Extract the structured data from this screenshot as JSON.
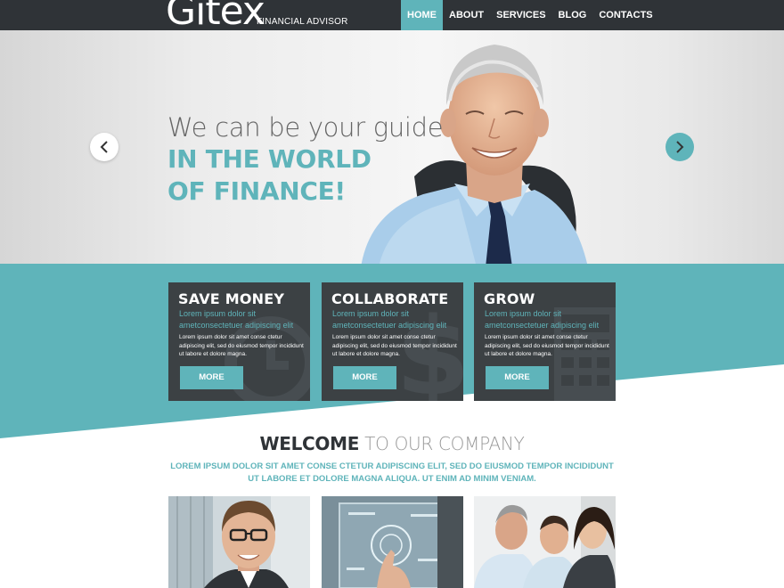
{
  "header": {
    "logo": "Gitex",
    "tagline": "FINANCIAL ADVISOR",
    "nav": [
      {
        "label": "HOME",
        "active": true
      },
      {
        "label": "ABOUT",
        "active": false
      },
      {
        "label": "SERVICES",
        "active": false
      },
      {
        "label": "BLOG",
        "active": false
      },
      {
        "label": "CONTACTS",
        "active": false
      }
    ]
  },
  "hero": {
    "line1": "We can be your guide",
    "line2": "IN THE WORLD",
    "line3": "OF FINANCE!",
    "prev_icon": "chevron-left-icon",
    "next_icon": "chevron-right-icon"
  },
  "cards": [
    {
      "title": "SAVE MONEY",
      "subtitle": "Lorem ipsum dolor sit ametconsectetuer adipiscing elit",
      "text": "Lorem ipsum dolor sit amet conse ctetur adipiscing elit, sed do eiusmod tempor incididunt ut labore et dolore magna.",
      "button": "MORE",
      "icon": "clock-icon"
    },
    {
      "title": "COLLABORATE",
      "subtitle": "Lorem ipsum dolor sit ametconsectetuer adipiscing elit",
      "text": "Lorem ipsum dolor sit amet conse ctetur adipiscing elit, sed do eiusmod tempor incididunt ut labore et dolore magna.",
      "button": "MORE",
      "icon": "dollar-icon"
    },
    {
      "title": "GROW",
      "subtitle": "Lorem ipsum dolor sit ametconsectetuer adipiscing elit",
      "text": "Lorem ipsum dolor sit amet conse ctetur adipiscing elit, sed do eiusmod tempor incididunt ut labore et dolore magna.",
      "button": "MORE",
      "icon": "calculator-icon"
    }
  ],
  "welcome": {
    "bold": "WELCOME",
    "light": " TO OUR COMPANY",
    "subtitle": "LOREM IPSUM DOLOR SIT AMET CONSE CTETUR ADIPISCING ELIT, SED DO EIUSMOD TEMPOR INCIDIDUNT UT LABORE ET DOLORE MAGNA ALIQUA. UT ENIM AD MINIM VENIAM."
  },
  "colors": {
    "accent": "#5fb4ba",
    "header_bg": "#2f3337",
    "card_bg": "#3c4144"
  }
}
